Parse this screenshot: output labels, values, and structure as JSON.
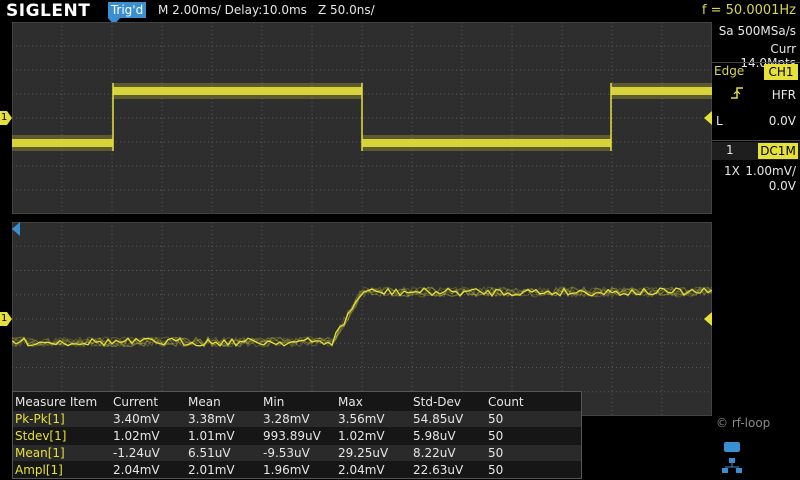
{
  "header": {
    "brand": "SIGLENT",
    "trigger_status": "Trig'd",
    "timebase": "M 2.00ms/ Delay:10.0ms",
    "zoom": "Z 50.0ns/",
    "frequency": "f = 50.0001Hz"
  },
  "acq": {
    "sample_rate": "Sa 500MSa/s",
    "memory": "Curr 14.0Mpts"
  },
  "trigger": {
    "mode_label": "Edge",
    "source": "CH1",
    "coupling": "HFR",
    "level_prefix": "L",
    "level": "0.0V"
  },
  "channel": {
    "number": "1",
    "coupling": "DC1M",
    "probe": "1X",
    "scale": "1.00mV/",
    "offset": "0.0V"
  },
  "markers": {
    "ch1_label": "1"
  },
  "measure": {
    "headers": [
      "Measure Item",
      "Current",
      "Mean",
      "Min",
      "Max",
      "Std-Dev",
      "Count"
    ],
    "rows": [
      [
        "Pk-Pk[1]",
        "3.40mV",
        "3.38mV",
        "3.28mV",
        "3.56mV",
        "54.85uV",
        "50"
      ],
      [
        "Stdev[1]",
        "1.02mV",
        "1.01mV",
        "993.89uV",
        "1.02mV",
        "5.98uV",
        "50"
      ],
      [
        "Mean[1]",
        "-1.24uV",
        "6.51uV",
        "-9.53uV",
        "29.25uV",
        "8.22uV",
        "50"
      ],
      [
        "Ampl[1]",
        "2.04mV",
        "2.01mV",
        "1.96mV",
        "2.04mV",
        "22.63uV",
        "50"
      ]
    ]
  },
  "watermark": "© rf-loop",
  "colors": {
    "trace": "#e5e03a",
    "trig_badge": "#3a8fd0",
    "grid": "#5a5a5a"
  }
}
